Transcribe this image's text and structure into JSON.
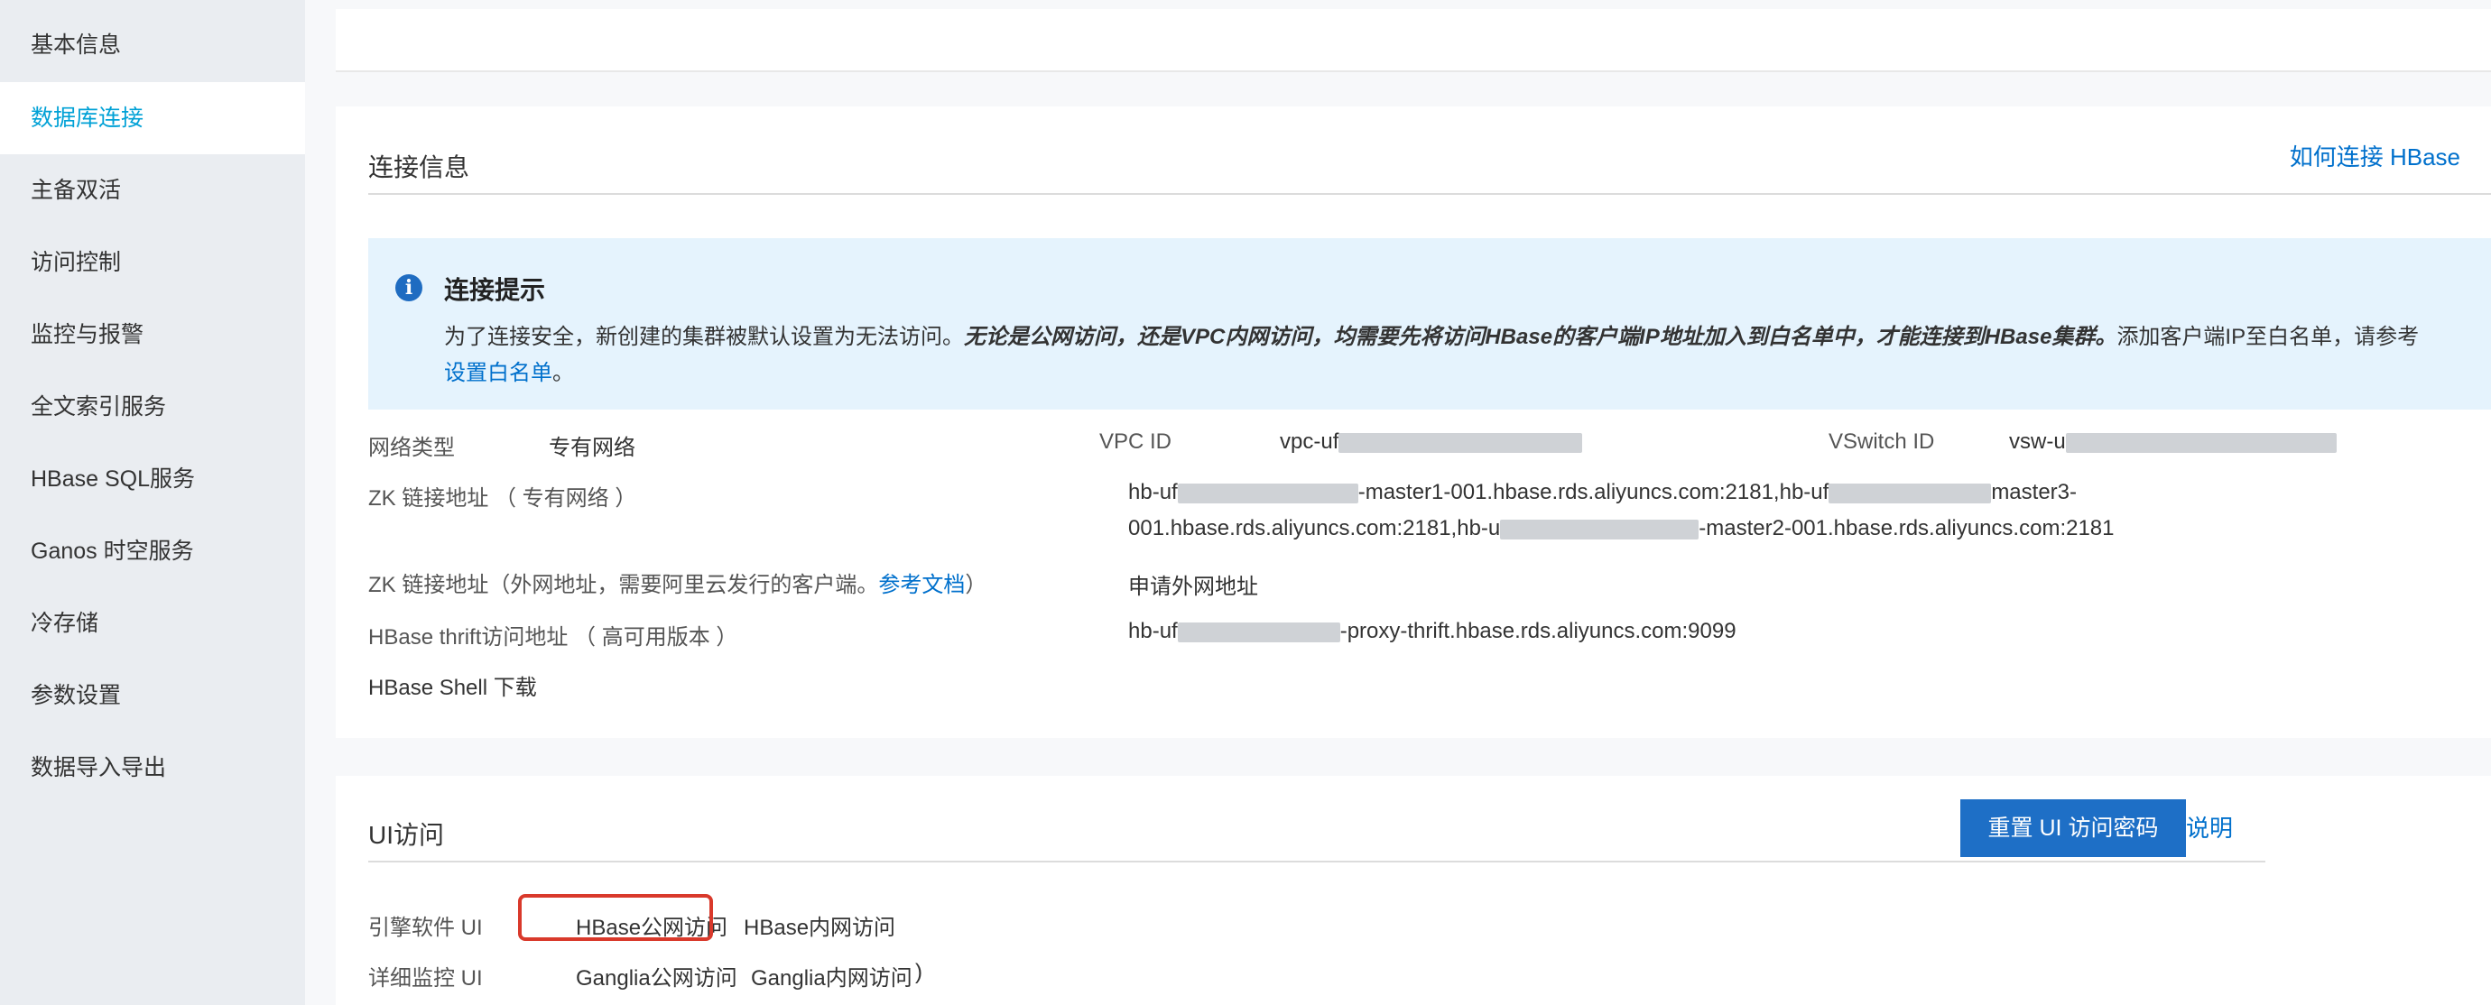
{
  "sidebar": {
    "items": [
      {
        "label": "基本信息"
      },
      {
        "label": "数据库连接",
        "active": true
      },
      {
        "label": "主备双活"
      },
      {
        "label": "访问控制"
      },
      {
        "label": "监控与报警"
      },
      {
        "label": "全文索引服务"
      },
      {
        "label": "HBase SQL服务"
      },
      {
        "label": "Ganos 时空服务"
      },
      {
        "label": "冷存储"
      },
      {
        "label": "参数设置"
      },
      {
        "label": "数据导入导出"
      }
    ]
  },
  "conn": {
    "title": "连接信息",
    "help_link": "如何连接 HBase",
    "notice": {
      "title": "连接提示",
      "text_prefix": "为了连接安全，新创建的集群被默认设置为无法访问。",
      "text_bold": "无论是公网访问，还是VPC内网访问，均需要先将访问HBase的客户端IP地址加入到白名单中，才能连接到HBase集群。",
      "text_suffix": "添加客户端IP至白名单，请参考",
      "link": "设置白名单",
      "end": "。"
    },
    "network_type_label": "网络类型",
    "network_type_value": "专有网络",
    "vpc_label": "VPC ID",
    "vpc_value_prefix": "vpc-uf",
    "vswitch_label": "VSwitch ID",
    "vswitch_value_prefix": "vsw-u",
    "zk_vpc_label": "ZK 链接地址 （ 专有网络 ）",
    "zk_vpc_line1_a": "hb-uf",
    "zk_vpc_line1_b": "-master1-001.hbase.rds.aliyuncs.com:2181,hb-uf",
    "zk_vpc_line1_c": "master3-",
    "zk_vpc_line2_a": "001.hbase.rds.aliyuncs.com:2181,hb-u",
    "zk_vpc_line2_b": "-master2-001.hbase.rds.aliyuncs.com:2181",
    "zk_public_label": "ZK 链接地址（外网地址，需要阿里云发行的客户端。",
    "zk_public_doc_link": "参考文档",
    "zk_public_label_end": "）",
    "apply_public_link": "申请外网地址",
    "thrift_label": "HBase thrift访问地址 （ 高可用版本 ）",
    "thrift_value_a": "hb-uf",
    "thrift_value_b": "-proxy-thrift.hbase.rds.aliyuncs.com:9099",
    "shell_link": "HBase Shell 下载"
  },
  "ui": {
    "title": "UI访问",
    "help_link": "UI 访问说明",
    "reset_button": "重置 UI 访问密码",
    "engine_label": "引擎软件 UI",
    "engine_public": "HBase公网访问",
    "engine_private": "HBase内网访问",
    "monitor_label": "详细监控 UI",
    "monitor_public": "Ganglia公网访问",
    "monitor_private": "Ganglia内网访问",
    "monitor_end": ")"
  },
  "colors": {
    "accent": "#0070cc",
    "active_sidebar": "#00a1d6",
    "highlight": "#d9392b",
    "notice_bg": "#e5f3fd"
  }
}
